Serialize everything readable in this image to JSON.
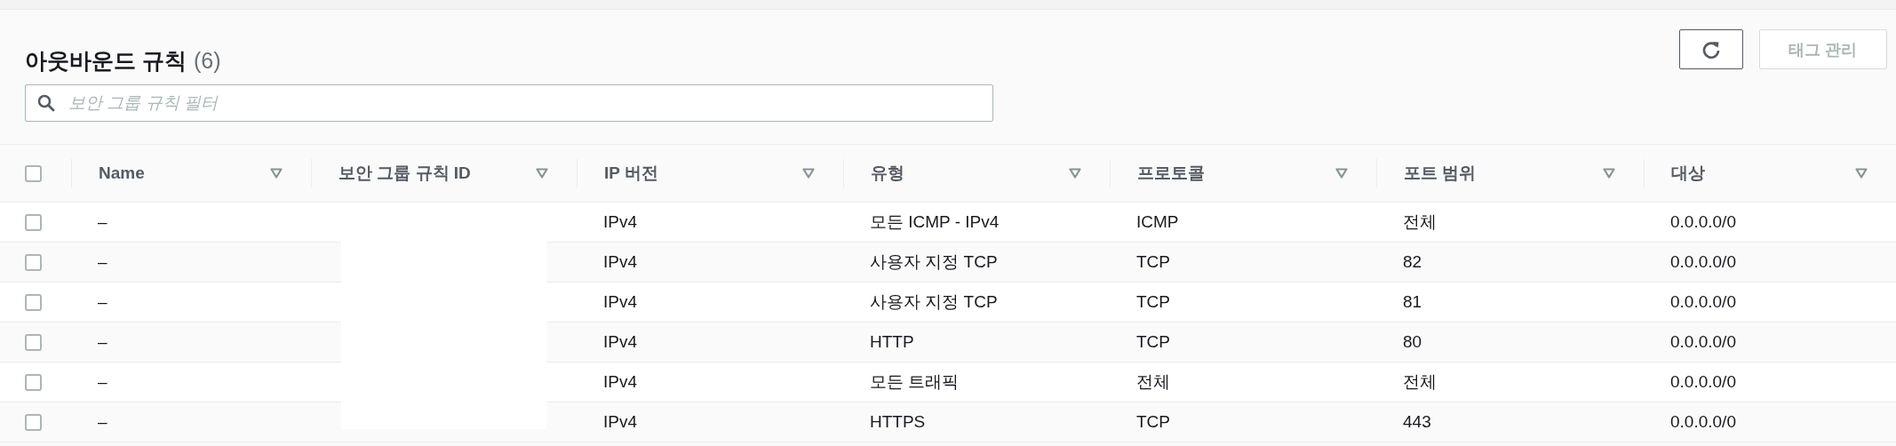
{
  "header": {
    "title": "아웃바운드 규칙",
    "count": "(6)"
  },
  "toolbar": {
    "refresh": {
      "disabled": false
    },
    "tag_button": {
      "label": "태그 관리",
      "disabled": true
    }
  },
  "search": {
    "placeholder": "보안 그룹 규칙 필터"
  },
  "table": {
    "select_all": {
      "checked": false
    },
    "columns": [
      "Name",
      "보안 그룹 규칙 ID",
      "IP 버전",
      "유형",
      "프로토콜",
      "포트 범위",
      "대상"
    ],
    "rows": [
      {
        "checked": false,
        "name": "–",
        "ip_version": "IPv4",
        "type": "모든 ICMP - IPv4",
        "protocol": "ICMP",
        "port_range": "전체",
        "destination": "0.0.0.0/0"
      },
      {
        "checked": false,
        "name": "–",
        "ip_version": "IPv4",
        "type": "사용자 지정 TCP",
        "protocol": "TCP",
        "port_range": "82",
        "destination": "0.0.0.0/0"
      },
      {
        "checked": false,
        "name": "–",
        "ip_version": "IPv4",
        "type": "사용자 지정 TCP",
        "protocol": "TCP",
        "port_range": "81",
        "destination": "0.0.0.0/0"
      },
      {
        "checked": false,
        "name": "–",
        "ip_version": "IPv4",
        "type": "HTTP",
        "protocol": "TCP",
        "port_range": "80",
        "destination": "0.0.0.0/0"
      },
      {
        "checked": false,
        "name": "–",
        "ip_version": "IPv4",
        "type": "모든 트래픽",
        "protocol": "전체",
        "port_range": "전체",
        "destination": "0.0.0.0/0"
      },
      {
        "checked": false,
        "name": "–",
        "ip_version": "IPv4",
        "type": "HTTPS",
        "protocol": "TCP",
        "port_range": "443",
        "destination": "0.0.0.0/0"
      }
    ]
  }
}
